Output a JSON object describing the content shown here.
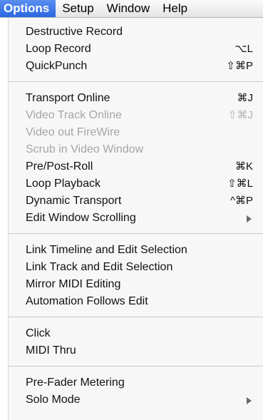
{
  "menubar": {
    "items": [
      {
        "label": "Options",
        "active": true
      },
      {
        "label": "Setup"
      },
      {
        "label": "Window"
      },
      {
        "label": "Help"
      }
    ]
  },
  "menu": {
    "groups": [
      {
        "items": [
          {
            "label": "Destructive Record",
            "shortcut": "",
            "enabled": true
          },
          {
            "label": "Loop Record",
            "shortcut": "⌥L",
            "enabled": true
          },
          {
            "label": "QuickPunch",
            "shortcut": "⇧⌘P",
            "enabled": true
          }
        ]
      },
      {
        "items": [
          {
            "label": "Transport Online",
            "shortcut": "⌘J",
            "enabled": true
          },
          {
            "label": "Video Track Online",
            "shortcut": "⇧⌘J",
            "enabled": false
          },
          {
            "label": "Video out FireWire",
            "shortcut": "",
            "enabled": false
          },
          {
            "label": "Scrub in Video Window",
            "shortcut": "",
            "enabled": false
          },
          {
            "label": "Pre/Post-Roll",
            "shortcut": "⌘K",
            "enabled": true
          },
          {
            "label": "Loop Playback",
            "shortcut": "⇧⌘L",
            "enabled": true
          },
          {
            "label": "Dynamic Transport",
            "shortcut": "^⌘P",
            "enabled": true
          },
          {
            "label": "Edit Window Scrolling",
            "shortcut": "",
            "enabled": true,
            "submenu": true
          }
        ]
      },
      {
        "items": [
          {
            "label": "Link Timeline and Edit Selection",
            "shortcut": "",
            "enabled": true
          },
          {
            "label": "Link Track and Edit Selection",
            "shortcut": "",
            "enabled": true
          },
          {
            "label": "Mirror MIDI Editing",
            "shortcut": "",
            "enabled": true
          },
          {
            "label": "Automation Follows Edit",
            "shortcut": "",
            "enabled": true
          }
        ]
      },
      {
        "items": [
          {
            "label": "Click",
            "shortcut": "",
            "enabled": true
          },
          {
            "label": "MIDI Thru",
            "shortcut": "",
            "enabled": true
          }
        ]
      },
      {
        "items": [
          {
            "label": "Pre-Fader Metering",
            "shortcut": "",
            "enabled": true
          },
          {
            "label": "Solo Mode",
            "shortcut": "",
            "enabled": true,
            "submenu": true
          }
        ]
      }
    ]
  },
  "colors": {
    "highlight": "#2c67e1",
    "disabled_text": "#a5a5a5",
    "menu_background": "#f7f7f7"
  }
}
